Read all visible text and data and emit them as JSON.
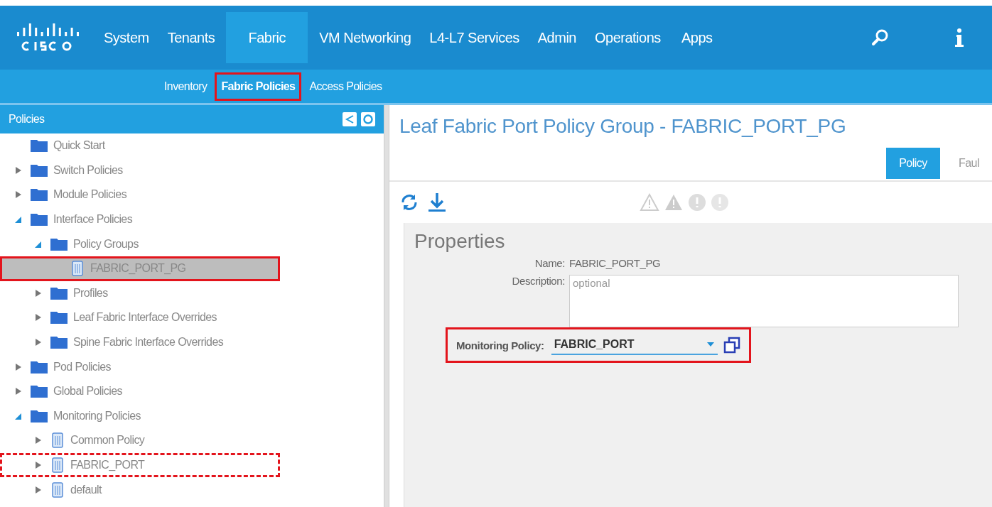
{
  "nav": {
    "items": [
      {
        "label": "System",
        "selected": false
      },
      {
        "label": "Tenants",
        "selected": false
      },
      {
        "label": "Fabric",
        "selected": true
      },
      {
        "label": "VM Networking",
        "selected": false
      },
      {
        "label": "L4-L7 Services",
        "selected": false
      },
      {
        "label": "Admin",
        "selected": false
      },
      {
        "label": "Operations",
        "selected": false
      },
      {
        "label": "Apps",
        "selected": false
      }
    ]
  },
  "subnav": {
    "items": [
      {
        "label": "Inventory",
        "selected": false,
        "highlighted": false
      },
      {
        "label": "Fabric Policies",
        "selected": true,
        "highlighted": true
      },
      {
        "label": "Access Policies",
        "selected": false,
        "highlighted": false
      }
    ]
  },
  "sidebar": {
    "title": "Policies",
    "items": [
      {
        "label": "Quick Start",
        "kind": "folder",
        "highlighted": false,
        "selected": false
      },
      {
        "label": "Switch Policies",
        "kind": "folder",
        "expanded": false,
        "highlighted": false,
        "selected": false
      },
      {
        "label": "Module Policies",
        "kind": "folder",
        "expanded": false,
        "highlighted": false,
        "selected": false
      },
      {
        "label": "Interface Policies",
        "kind": "folder",
        "expanded": true,
        "highlighted": false,
        "selected": false,
        "children": [
          {
            "label": "Policy Groups",
            "kind": "folder",
            "expanded": true,
            "highlighted": false,
            "selected": false,
            "children": [
              {
                "label": "FABRIC_PORT_PG",
                "kind": "policy",
                "highlighted": true,
                "selected": true
              }
            ]
          },
          {
            "label": "Profiles",
            "kind": "folder",
            "expanded": false,
            "highlighted": false,
            "selected": false
          },
          {
            "label": "Leaf Fabric Interface Overrides",
            "kind": "folder",
            "expanded": false,
            "highlighted": false,
            "selected": false
          },
          {
            "label": "Spine Fabric Interface Overrides",
            "kind": "folder",
            "expanded": false,
            "highlighted": false,
            "selected": false
          }
        ]
      },
      {
        "label": "Pod Policies",
        "kind": "folder",
        "expanded": false,
        "highlighted": false,
        "selected": false
      },
      {
        "label": "Global Policies",
        "kind": "folder",
        "expanded": false,
        "highlighted": false,
        "selected": false
      },
      {
        "label": "Monitoring Policies",
        "kind": "folder",
        "expanded": true,
        "highlighted": false,
        "selected": false,
        "children": [
          {
            "label": "Common Policy",
            "kind": "policy",
            "expanded": false,
            "highlighted": false,
            "selected": false
          },
          {
            "label": "FABRIC_PORT",
            "kind": "policy",
            "expanded": false,
            "highlighted": true,
            "dashed": true,
            "selected": false
          },
          {
            "label": "default",
            "kind": "policy",
            "expanded": false,
            "highlighted": false,
            "selected": false
          }
        ]
      }
    ]
  },
  "content": {
    "title": "Leaf Fabric Port Policy Group - FABRIC_PORT_PG",
    "tabs": [
      {
        "label": "Policy",
        "selected": true
      },
      {
        "label": "Faul",
        "selected": false
      }
    ],
    "properties": {
      "heading": "Properties",
      "name_label": "Name:",
      "name_value": "FABRIC_PORT_PG",
      "description_label": "Description:",
      "description_placeholder": "optional",
      "monitoring_label": "Monitoring Policy:",
      "monitoring_value": "FABRIC_PORT",
      "monitoring_highlighted": true
    }
  }
}
